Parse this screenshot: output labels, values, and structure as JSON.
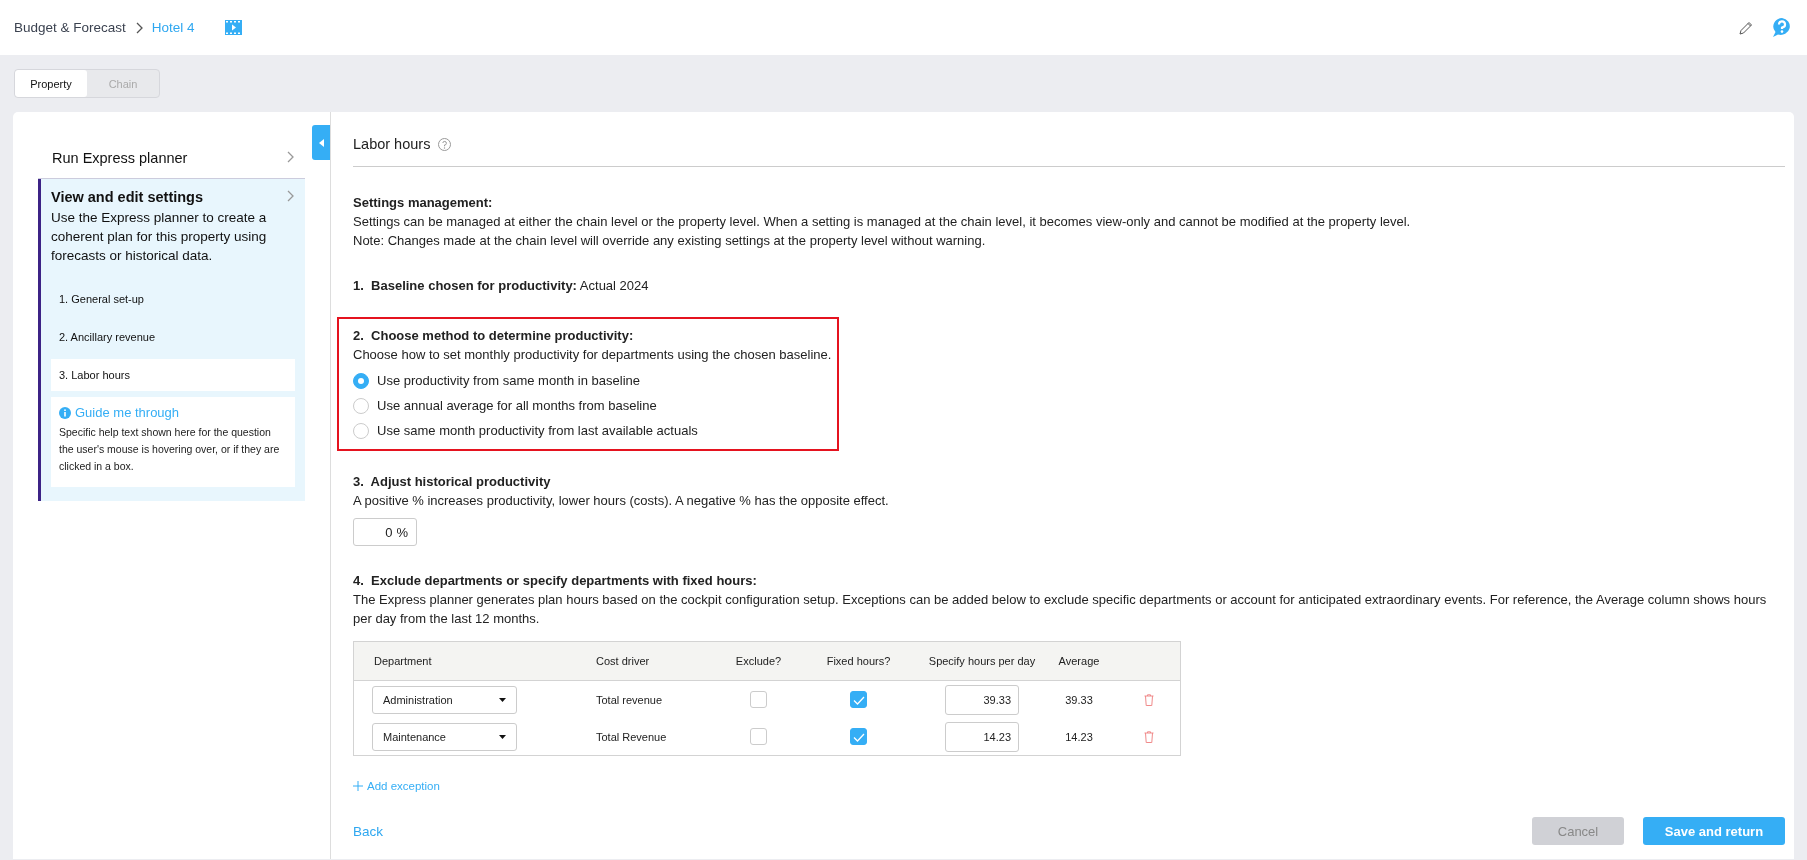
{
  "header": {
    "breadcrumb_root": "Budget & Forecast",
    "breadcrumb_current": "Hotel 4"
  },
  "tabs": [
    {
      "label": "Property",
      "selected": true
    },
    {
      "label": "Chain",
      "selected": false
    }
  ],
  "sidebar": {
    "items": [
      {
        "title": "Run Express planner",
        "selected": false
      },
      {
        "title": "View and edit settings",
        "selected": true,
        "description": "Use the Express planner to create a coherent plan for this property using forecasts or historical data.",
        "steps": [
          {
            "label": "1. General set-up",
            "selected": false
          },
          {
            "label": "2. Ancillary revenue",
            "selected": false
          },
          {
            "label": "3. Labor hours",
            "selected": true
          }
        ],
        "guide": {
          "title": "Guide me through",
          "text": "Specific help text shown here for the question the user's mouse is hovering over, or if they are clicked in a box."
        }
      }
    ]
  },
  "main": {
    "title": "Labor hours",
    "settings_management": {
      "heading": "Settings management:",
      "lines": [
        "Settings can be managed at either the chain level or the property level. When a setting is managed at the chain level, it becomes view-only and cannot be modified at the property level.",
        "Note: Changes made at the chain level will override any existing settings at the property level without warning."
      ]
    },
    "baseline": {
      "number": "1.",
      "label": "Baseline chosen for productivity:",
      "value": "Actual 2024"
    },
    "method": {
      "number": "2.",
      "heading": "Choose method to determine productivity:",
      "highlighted": true,
      "description": "Choose how to set monthly productivity for departments using the chosen baseline.",
      "options": [
        {
          "label": "Use productivity from same month in baseline",
          "selected": true
        },
        {
          "label": "Use annual average for all months from baseline",
          "selected": false
        },
        {
          "label": "Use same month productivity from last available actuals",
          "selected": false
        }
      ]
    },
    "adjust": {
      "number": "3.",
      "heading": "Adjust historical productivity",
      "description": "A positive % increases productivity, lower hours (costs). A negative % has the opposite effect.",
      "value": "0",
      "unit": "%"
    },
    "exclude": {
      "number": "4.",
      "heading": "Exclude departments or specify departments with fixed hours:",
      "description": "The Express planner generates plan hours based on the cockpit configuration setup. Exceptions can be added below to exclude specific departments or account for anticipated extraordinary events. For reference, the Average column shows hours per day from the last 12 months.",
      "table": {
        "columns": [
          "Department",
          "Cost driver",
          "Exclude?",
          "Fixed hours?",
          "Specify hours per day",
          "Average"
        ],
        "rows": [
          {
            "department": "Administration",
            "cost_driver": "Total revenue",
            "exclude": false,
            "fixed_hours": true,
            "hours_per_day": "39.33",
            "average": "39.33"
          },
          {
            "department": "Maintenance",
            "cost_driver": "Total Revenue",
            "exclude": false,
            "fixed_hours": true,
            "hours_per_day": "14.23",
            "average": "14.23"
          }
        ]
      },
      "add_label": "Add exception"
    },
    "footer": {
      "back": "Back",
      "cancel": {
        "label": "Cancel",
        "disabled": true
      },
      "save": "Save and return"
    }
  }
}
